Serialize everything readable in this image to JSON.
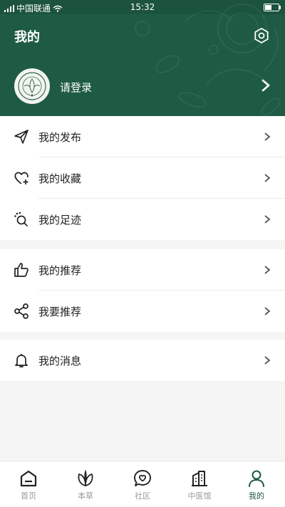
{
  "status_bar": {
    "carrier": "中国联通",
    "time": "15:32"
  },
  "header": {
    "title": "我的",
    "login_text": "请登录"
  },
  "menu_groups": [
    [
      {
        "label": "我的发布",
        "icon": "paper-plane-icon"
      },
      {
        "label": "我的收藏",
        "icon": "heart-plus-icon"
      },
      {
        "label": "我的足迹",
        "icon": "footprint-icon"
      }
    ],
    [
      {
        "label": "我的推荐",
        "icon": "thumbs-up-icon"
      },
      {
        "label": "我要推荐",
        "icon": "share-icon"
      }
    ],
    [
      {
        "label": "我的消息",
        "icon": "bell-icon"
      }
    ]
  ],
  "tabbar": [
    {
      "label": "首页",
      "icon": "home-icon"
    },
    {
      "label": "本草",
      "icon": "leaf-icon"
    },
    {
      "label": "社区",
      "icon": "chat-heart-icon"
    },
    {
      "label": "中医馆",
      "icon": "building-icon"
    },
    {
      "label": "我的",
      "icon": "user-icon",
      "active": true
    }
  ],
  "colors": {
    "brand": "#1f5b44",
    "background": "#f5f5f5"
  }
}
